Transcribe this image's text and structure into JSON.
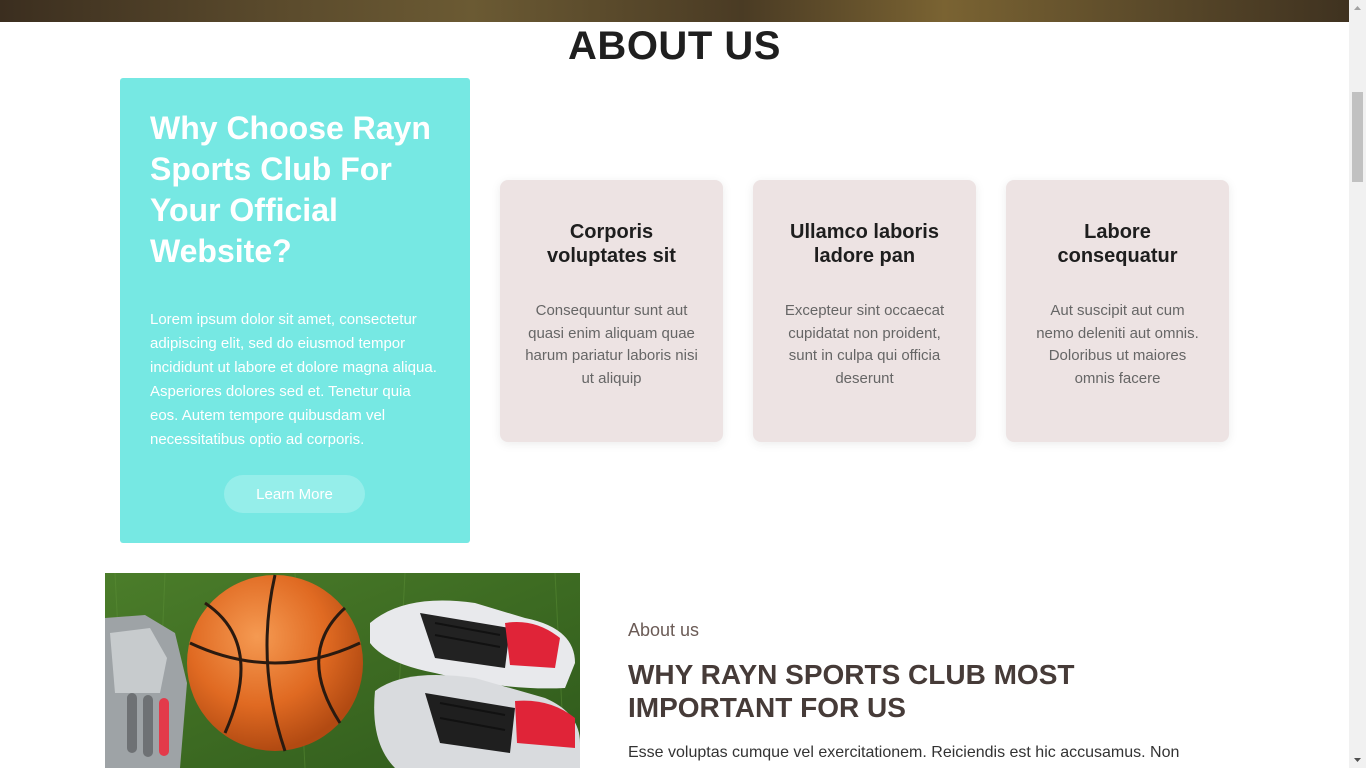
{
  "about_section": {
    "title": "ABOUT US",
    "why_box": {
      "title": "Why Choose Rayn Sports Club For Your Official Website?",
      "text": "Lorem ipsum dolor sit amet, consectetur adipiscing elit, sed do eiusmod tempor incididunt ut labore et dolore magna aliqua. Asperiores dolores sed et. Tenetur quia eos. Autem tempore quibusdam vel necessitatibus optio ad corporis.",
      "button_label": "Learn More"
    },
    "cards": [
      {
        "title": "Corporis voluptates sit",
        "text": "Consequuntur sunt aut quasi enim aliquam quae harum pariatur laboris nisi ut aliquip"
      },
      {
        "title": "Ullamco laboris ladore pan",
        "text": "Excepteur sint occaecat cupidatat non proident, sunt in culpa qui officia deserunt"
      },
      {
        "title": "Labore consequatur",
        "text": "Aut suscipit aut cum nemo deleniti aut omnis. Doloribus ut maiores omnis facere"
      }
    ]
  },
  "about_detail": {
    "label": "About us",
    "heading": "WHY RAYN SPORTS CLUB MOST IMPORTANT FOR US",
    "text": "Esse voluptas cumque vel exercitationem. Reiciendis est hic accusamus. Non"
  },
  "colors": {
    "why_box_bg": "#76e8e3",
    "card_bg": "#ede3e3",
    "heading_dark": "#463b38"
  },
  "icons": {
    "scroll_up": "chevron-up-icon",
    "scroll_down": "chevron-down-icon"
  }
}
